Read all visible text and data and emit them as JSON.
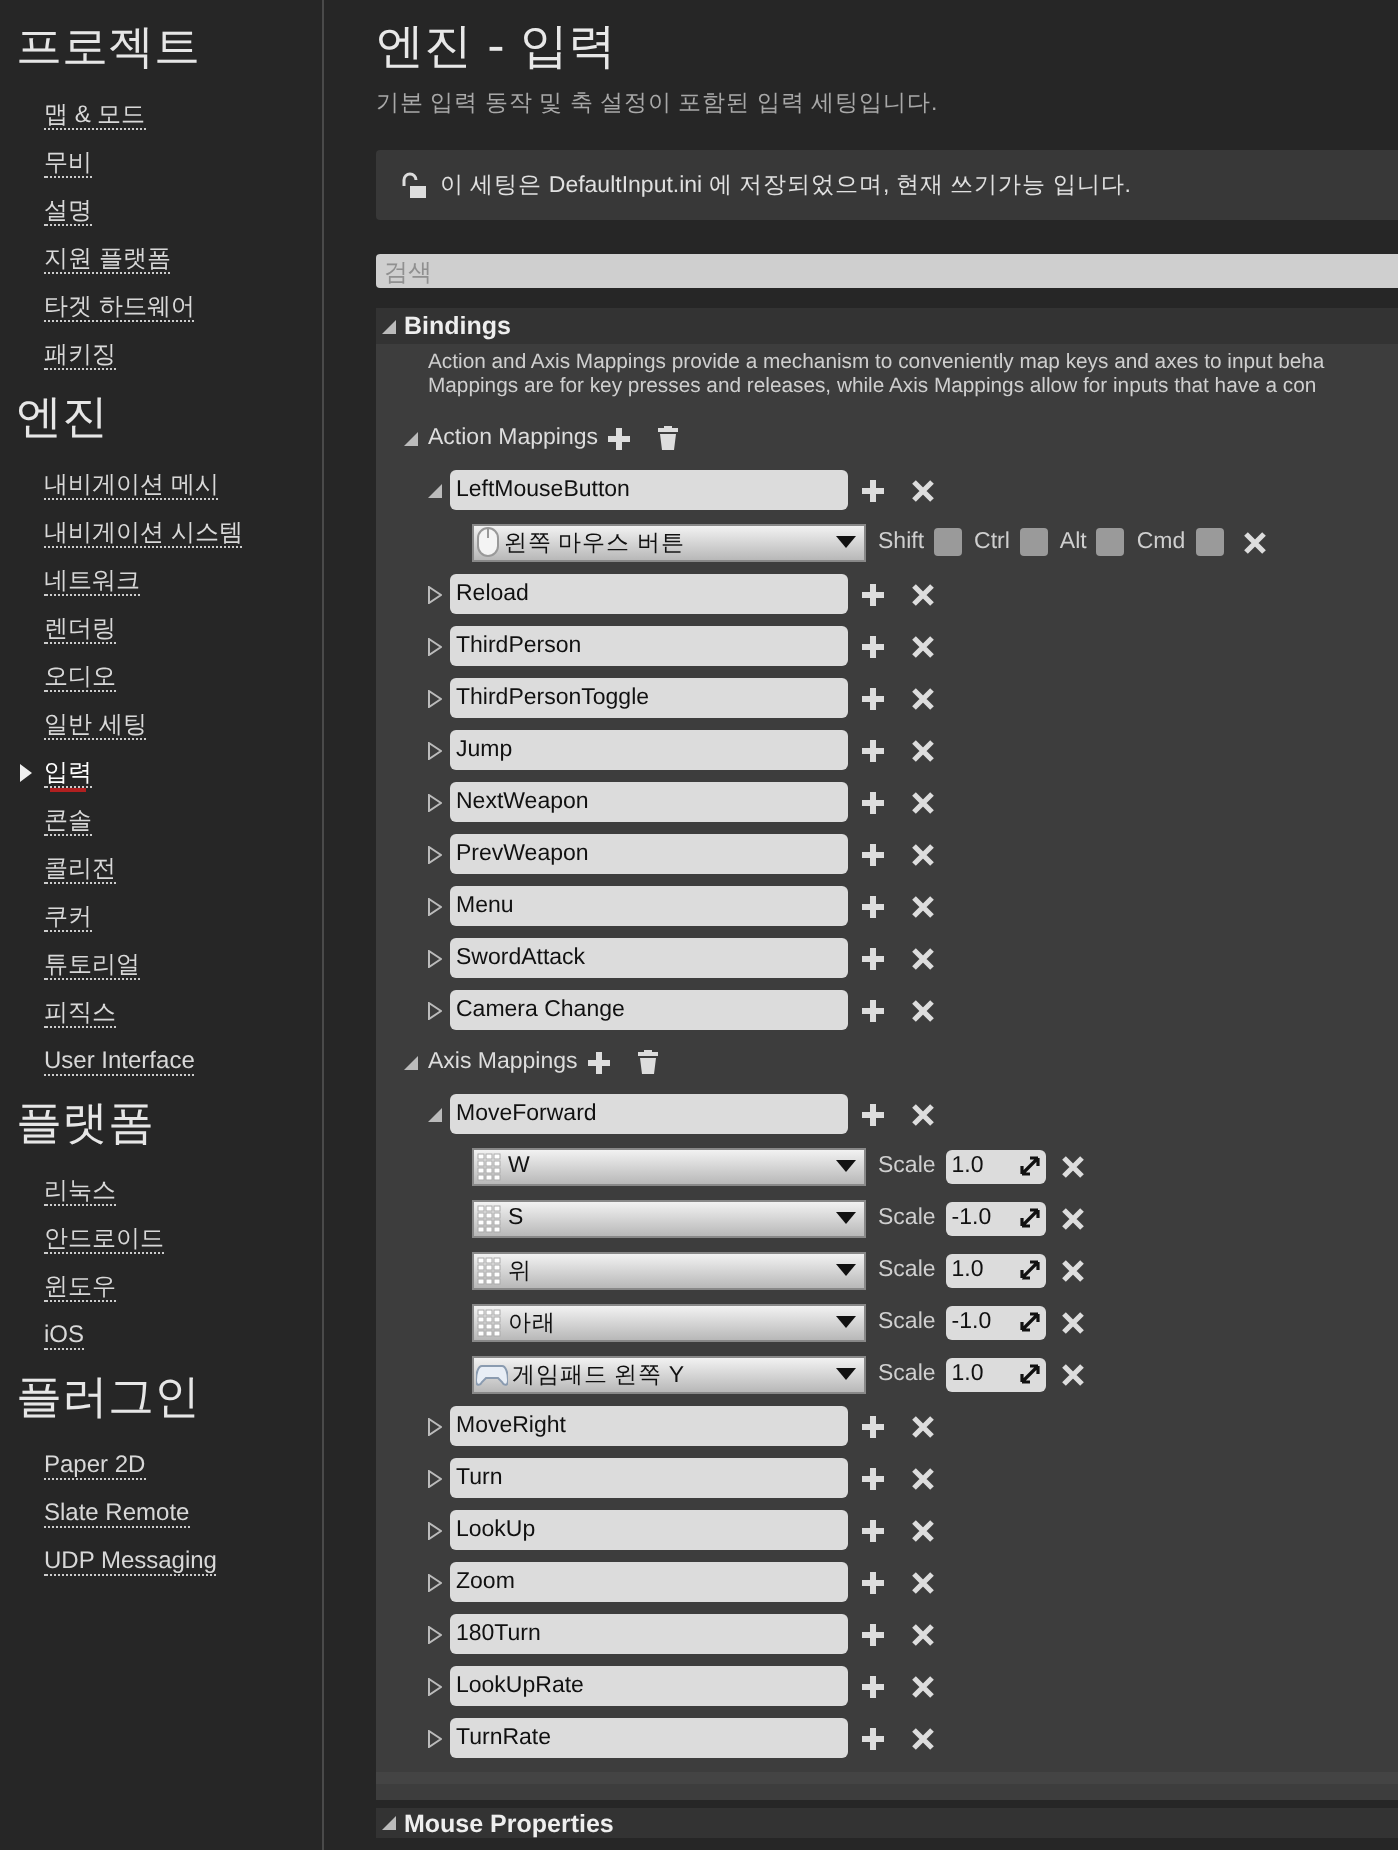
{
  "sidebar": [
    {
      "heading": "프로젝트",
      "items": [
        {
          "label": "맵 & 모드",
          "selected": false
        },
        {
          "label": "무비",
          "selected": false
        },
        {
          "label": "설명",
          "selected": false
        },
        {
          "label": "지원 플랫폼",
          "selected": false
        },
        {
          "label": "타겟 하드웨어",
          "selected": false
        },
        {
          "label": "패키징",
          "selected": false
        }
      ]
    },
    {
      "heading": "엔진",
      "items": [
        {
          "label": "내비게이션 메시",
          "selected": false
        },
        {
          "label": "내비게이션 시스템",
          "selected": false
        },
        {
          "label": "네트워크",
          "selected": false
        },
        {
          "label": "렌더링",
          "selected": false
        },
        {
          "label": "오디오",
          "selected": false
        },
        {
          "label": "일반 세팅",
          "selected": false
        },
        {
          "label": "입력",
          "selected": true
        },
        {
          "label": "콘솔",
          "selected": false
        },
        {
          "label": "콜리전",
          "selected": false
        },
        {
          "label": "쿠커",
          "selected": false
        },
        {
          "label": "튜토리얼",
          "selected": false
        },
        {
          "label": "피직스",
          "selected": false
        },
        {
          "label": "User Interface",
          "selected": false
        }
      ]
    },
    {
      "heading": "플랫폼",
      "items": [
        {
          "label": "리눅스",
          "selected": false
        },
        {
          "label": "안드로이드",
          "selected": false
        },
        {
          "label": "윈도우",
          "selected": false
        },
        {
          "label": "iOS",
          "selected": false
        }
      ]
    },
    {
      "heading": "플러그인",
      "items": [
        {
          "label": "Paper 2D",
          "selected": false
        },
        {
          "label": "Slate Remote",
          "selected": false
        },
        {
          "label": "UDP Messaging",
          "selected": false
        }
      ]
    }
  ],
  "page": {
    "title": "엔진 - 입력",
    "subtitle": "기본 입력 동작 및 축 설정이 포함된 입력 세팅입니다."
  },
  "notice": "이 세팅은 DefaultInput.ini 에 저장되었으며, 현재 쓰기가능 입니다.",
  "search": {
    "placeholder": "검색"
  },
  "bindings": {
    "title": "Bindings",
    "expanded": true,
    "description": [
      "Action and Axis Mappings provide a mechanism to conveniently map keys and axes to input beha",
      "Mappings are for key presses and releases, while Axis Mappings allow for inputs that have a con"
    ],
    "action_mappings": {
      "label": "Action Mappings",
      "expanded": true,
      "items": [
        {
          "name": "LeftMouseButton",
          "expanded": true,
          "keys": [
            {
              "key": "왼쪽 마우스 버튼",
              "kind": "mouse",
              "modifiers": [
                {
                  "label": "Shift",
                  "checked": false
                },
                {
                  "label": "Ctrl",
                  "checked": false
                },
                {
                  "label": "Alt",
                  "checked": false
                },
                {
                  "label": "Cmd",
                  "checked": false
                }
              ]
            }
          ]
        },
        {
          "name": "Reload",
          "expanded": false
        },
        {
          "name": "ThirdPerson",
          "expanded": false
        },
        {
          "name": "ThirdPersonToggle",
          "expanded": false
        },
        {
          "name": "Jump",
          "expanded": false
        },
        {
          "name": "NextWeapon",
          "expanded": false
        },
        {
          "name": "PrevWeapon",
          "expanded": false
        },
        {
          "name": "Menu",
          "expanded": false
        },
        {
          "name": "SwordAttack",
          "expanded": false
        },
        {
          "name": "Camera Change",
          "expanded": false
        }
      ]
    },
    "axis_mappings": {
      "label": "Axis Mappings",
      "expanded": true,
      "items": [
        {
          "name": "MoveForward",
          "expanded": true,
          "keys": [
            {
              "key": "W",
              "kind": "keyboard",
              "scale_label": "Scale",
              "scale": "1.0"
            },
            {
              "key": "S",
              "kind": "keyboard",
              "scale_label": "Scale",
              "scale": "-1.0"
            },
            {
              "key": "위",
              "kind": "keyboard",
              "scale_label": "Scale",
              "scale": "1.0"
            },
            {
              "key": "아래",
              "kind": "keyboard",
              "scale_label": "Scale",
              "scale": "-1.0"
            },
            {
              "key": "게임패드 왼쪽 Y",
              "kind": "gamepad",
              "scale_label": "Scale",
              "scale": "1.0"
            }
          ]
        },
        {
          "name": "MoveRight",
          "expanded": false
        },
        {
          "name": "Turn",
          "expanded": false
        },
        {
          "name": "LookUp",
          "expanded": false
        },
        {
          "name": "Zoom",
          "expanded": false
        },
        {
          "name": "180Turn",
          "expanded": false
        },
        {
          "name": "LookUpRate",
          "expanded": false
        },
        {
          "name": "TurnRate",
          "expanded": false
        }
      ]
    }
  },
  "next_section": {
    "title": "Mouse Properties",
    "expanded": true
  }
}
